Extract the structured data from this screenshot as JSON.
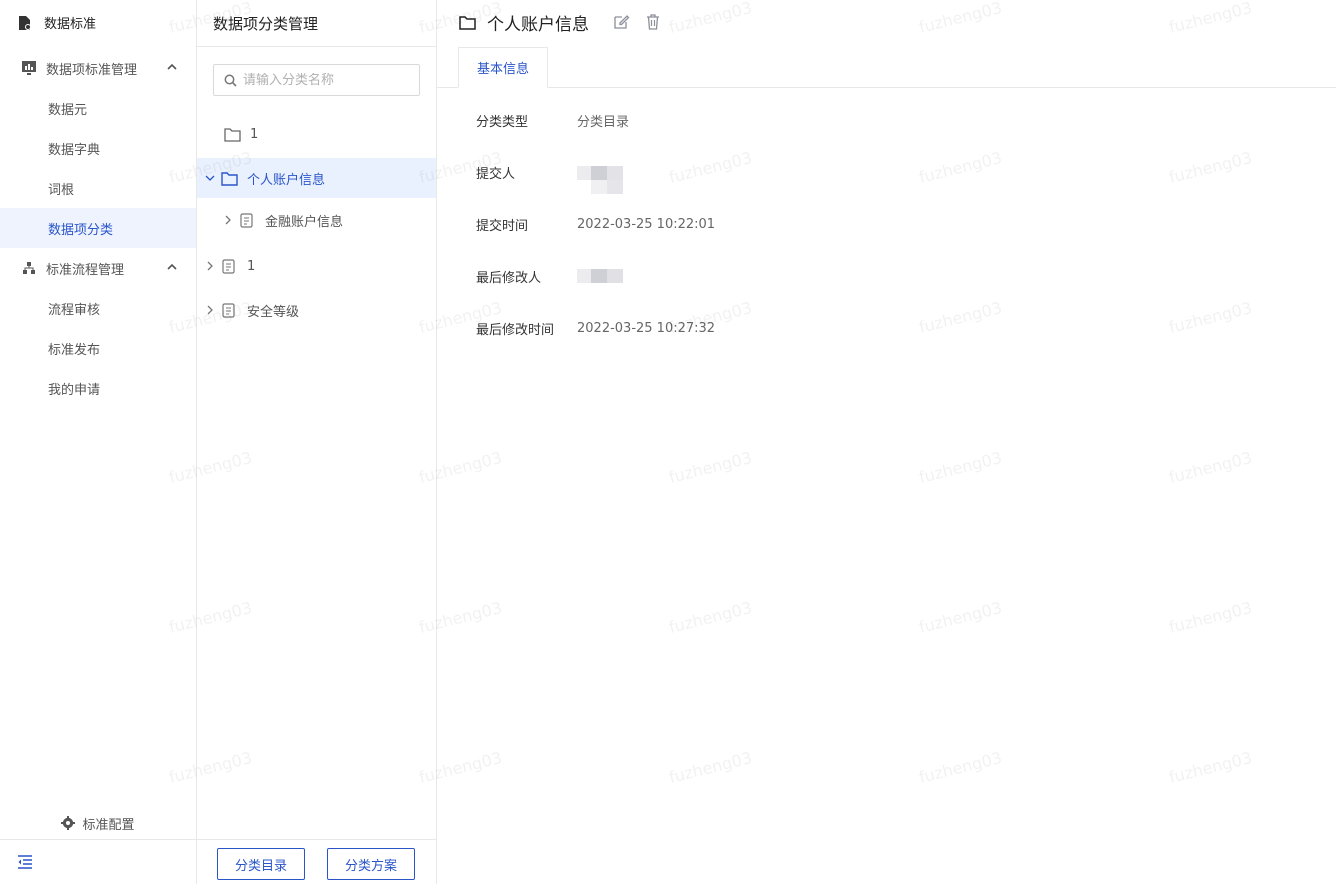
{
  "nav": {
    "brand": "数据标准",
    "groups": [
      {
        "label": "数据项标准管理",
        "items": [
          "数据元",
          "数据字典",
          "词根",
          "数据项分类"
        ]
      },
      {
        "label": "标准流程管理",
        "items": [
          "流程审核",
          "标准发布",
          "我的申请"
        ]
      }
    ],
    "config_label": "标准配置"
  },
  "tree": {
    "title": "数据项分类管理",
    "search_placeholder": "请输入分类名称",
    "nodes": [
      "1",
      "个人账户信息",
      "金融账户信息",
      "1",
      "安全等级"
    ],
    "btn_catalog": "分类目录",
    "btn_scheme": "分类方案"
  },
  "main": {
    "title": "个人账户信息",
    "tab": "基本信息",
    "fields": [
      {
        "label": "分类类型",
        "value": "分类目录"
      },
      {
        "label": "提交人",
        "value": ""
      },
      {
        "label": "提交时间",
        "value": "2022-03-25 10:22:01"
      },
      {
        "label": "最后修改人",
        "value": ""
      },
      {
        "label": "最后修改时间",
        "value": "2022-03-25 10:27:32"
      }
    ]
  },
  "watermark": "fuzheng03",
  "colors": {
    "accent": "#2a55c9",
    "selected_bg": "#eaf1fe"
  }
}
